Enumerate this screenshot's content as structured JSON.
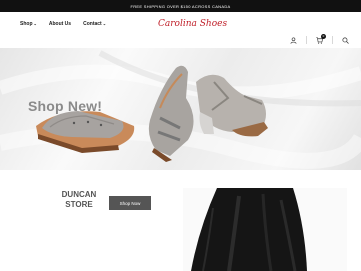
{
  "topbar": {
    "text": "FREE SHIPPING OVER $150 ACROSS CANADA"
  },
  "nav": {
    "items": [
      {
        "label": "Shop",
        "has_dropdown": true
      },
      {
        "label": "About Us",
        "has_dropdown": false
      },
      {
        "label": "Contact",
        "has_dropdown": true
      }
    ]
  },
  "logo": {
    "text": "Carolina Shoes"
  },
  "header_icons": {
    "account": "user-icon",
    "cart": "cart-icon",
    "cart_count": "0",
    "search": "search-icon"
  },
  "hero": {
    "title": "Shop New!"
  },
  "store_section": {
    "title_line1": "DUNCAN",
    "title_line2": "STORE",
    "button_label": "Shop Now"
  },
  "colors": {
    "topbar": "#111111",
    "logo": "#c0202a",
    "button": "#555555",
    "hero_text": "#8a8a8a"
  }
}
